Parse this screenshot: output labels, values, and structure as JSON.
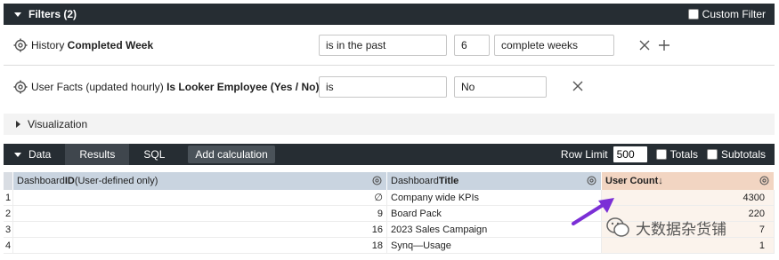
{
  "filters": {
    "title": "Filters (2)",
    "custom_filter_label": "Custom Filter",
    "row1": {
      "label_prefix": "History ",
      "label_bold": "Completed Week",
      "operator": "is in the past",
      "value": "6",
      "unit": "complete weeks"
    },
    "row2": {
      "label_prefix": "User Facts (updated hourly) ",
      "label_bold": "Is Looker Employee (Yes / No)",
      "operator": "is",
      "value": "No"
    }
  },
  "visualization": {
    "label": "Visualization"
  },
  "data_bar": {
    "title": "Data",
    "tabs": [
      "Results",
      "SQL"
    ],
    "add_calculation": "Add calculation",
    "row_limit_label": "Row Limit",
    "row_limit_value": "500",
    "totals_label": "Totals",
    "subtotals_label": "Subtotals"
  },
  "table": {
    "columns": [
      {
        "prefix": "Dashboard ",
        "bold": "ID",
        "suffix": " (User-defined only)"
      },
      {
        "prefix": "Dashboard ",
        "bold": "Title",
        "suffix": ""
      },
      {
        "prefix": "",
        "bold": "User Count",
        "suffix": " ↓"
      }
    ],
    "rows": [
      {
        "idx": "1",
        "id": "∅",
        "title": "Company wide KPIs",
        "count": "4300"
      },
      {
        "idx": "2",
        "id": "9",
        "title": "Board Pack",
        "count": "220"
      },
      {
        "idx": "3",
        "id": "16",
        "title": "2023 Sales Campaign",
        "count": "7"
      },
      {
        "idx": "4",
        "id": "18",
        "title": "Synq—Usage",
        "count": "1"
      }
    ]
  },
  "watermark": {
    "text": "大数据杂货铺"
  },
  "colors": {
    "header_dark": "#262d33",
    "dimension_header": "#c9d4e0",
    "measure_header": "#f2d5c2",
    "arrow": "#7b2fd6"
  },
  "icons": [
    "gear-icon",
    "close-icon",
    "plus-icon",
    "caret-down-icon",
    "caret-right-icon",
    "arrow-icon"
  ]
}
